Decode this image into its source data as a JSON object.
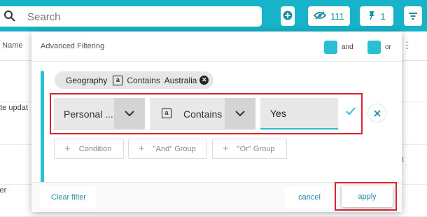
{
  "toolbar": {
    "search_placeholder": "Search",
    "hidden_count": "111",
    "pinned_count": "1"
  },
  "background_table": {
    "column_header": "n Name",
    "rows": [
      "ate updat",
      "ser"
    ],
    "right_text": "t"
  },
  "modal": {
    "title": "Advanced Filtering",
    "legend_and": "and",
    "legend_or": "or",
    "existing_condition": {
      "field": "Geography",
      "operator": "Contains",
      "value": "Australia"
    },
    "editing_condition": {
      "field": "Personal ...",
      "operator": "Contains",
      "value": "Yes"
    },
    "buttons": {
      "condition": "Condition",
      "and_group": "\"And\" Group",
      "or_group": "\"Or\" Group",
      "clear_filter": "Clear filter",
      "cancel": "cancel",
      "apply": "apply"
    },
    "colors": {
      "accent": "#28c0d3",
      "toolbar": "#17b3c9",
      "highlight": "#d9252f"
    }
  }
}
